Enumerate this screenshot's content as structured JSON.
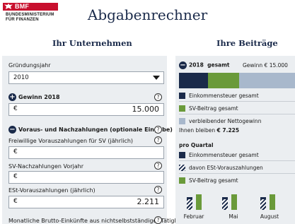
{
  "logo": {
    "bar_text": "BMF",
    "line1": "BUNDESMINISTERIUM",
    "line2": "FÜR FINANZEN"
  },
  "app_title": "Abgabenrechner",
  "left": {
    "title": "Ihr Unternehmen",
    "gruendungsjahr": {
      "label": "Gründungsjahr",
      "value": "2010"
    },
    "gewinn": {
      "label": "Gewinn 2018",
      "currency": "€",
      "value": "15.000"
    },
    "vorauszahlungen": {
      "label": "Voraus- und Nachzahlungen (optionale Eingabe)",
      "sv_voraus": {
        "label": "Freiwillige Vorauszahlungen für SV (jährlich)",
        "currency": "€",
        "value": ""
      },
      "sv_nach": {
        "label": "SV-Nachzahlungen Vorjahr",
        "currency": "€",
        "value": ""
      },
      "est_voraus": {
        "label": "ESt-Vorauszahlungen (jährlich)",
        "currency": "€",
        "value": "2.211"
      }
    },
    "monatlich_label": "Monatliche Brutto-Einkünfte aus nichtselbstständiger Tätigkeit"
  },
  "right": {
    "title": "Ihre Beiträge",
    "year": "2018",
    "year_suffix": "gesamt",
    "gewinn_text": "Gewinn € 15.000",
    "legend": [
      {
        "label": "Einkommensteuer gesamt",
        "color": "#1a2a4a"
      },
      {
        "label": "SV-Beitrag gesamt",
        "color": "#6a9a3a"
      },
      {
        "label": "verbleibender Nettogewinn",
        "color": "#a8b8cc"
      }
    ],
    "bleiben_prefix": "Ihnen bleiben",
    "bleiben_value": "€ 7.225",
    "quartal_title": "pro Quartal",
    "quartal_legend": [
      {
        "label": "Einkommensteuer gesamt",
        "type": "solid"
      },
      {
        "label": "davon ESt-Vorauszahlungen",
        "type": "hatch"
      },
      {
        "label": "SV-Beitrag gesamt",
        "type": "green"
      }
    ],
    "months": [
      "Februar",
      "Mai",
      "August"
    ],
    "stack_fractions": {
      "est": 0.25,
      "sv": 0.27,
      "net": 0.48
    }
  },
  "help_icon": "?"
}
